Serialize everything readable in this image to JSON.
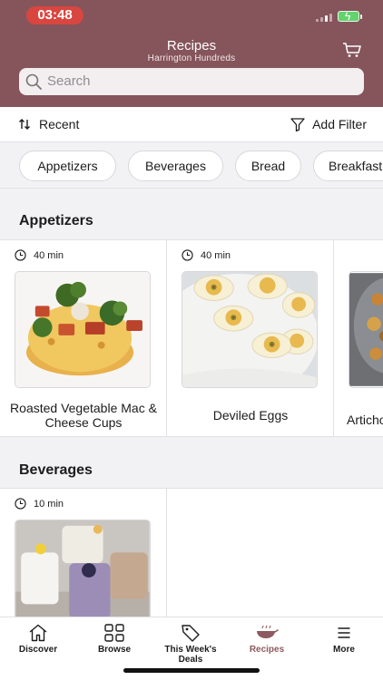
{
  "status": {
    "time": "03:48"
  },
  "header": {
    "title": "Recipes",
    "subtitle": "Harrington Hundreds"
  },
  "search": {
    "placeholder": "Search"
  },
  "toolbar": {
    "sort_label": "Recent",
    "filter_label": "Add Filter"
  },
  "chips": [
    "Appetizers",
    "Beverages",
    "Bread",
    "Breakfast"
  ],
  "sections": [
    {
      "title": "Appetizers",
      "cards": [
        {
          "time": "40 min",
          "title": "Roasted Vegetable Mac & Cheese Cups"
        },
        {
          "time": "40 min",
          "title": "Deviled Eggs"
        },
        {
          "time": "",
          "title": "Artichoke"
        }
      ]
    },
    {
      "title": "Beverages",
      "cards": [
        {
          "time": "10 min",
          "title": ""
        }
      ]
    }
  ],
  "tabs": [
    {
      "label": "Discover",
      "icon": "home-icon"
    },
    {
      "label": "Browse",
      "icon": "grid-icon"
    },
    {
      "label": "This Week's Deals",
      "icon": "tag-icon"
    },
    {
      "label": "Recipes",
      "icon": "wok-icon"
    },
    {
      "label": "More",
      "icon": "menu-icon"
    }
  ],
  "colors": {
    "header": "#85555b",
    "active_tab": "#8d5a60",
    "status_time": "#d9463f"
  }
}
